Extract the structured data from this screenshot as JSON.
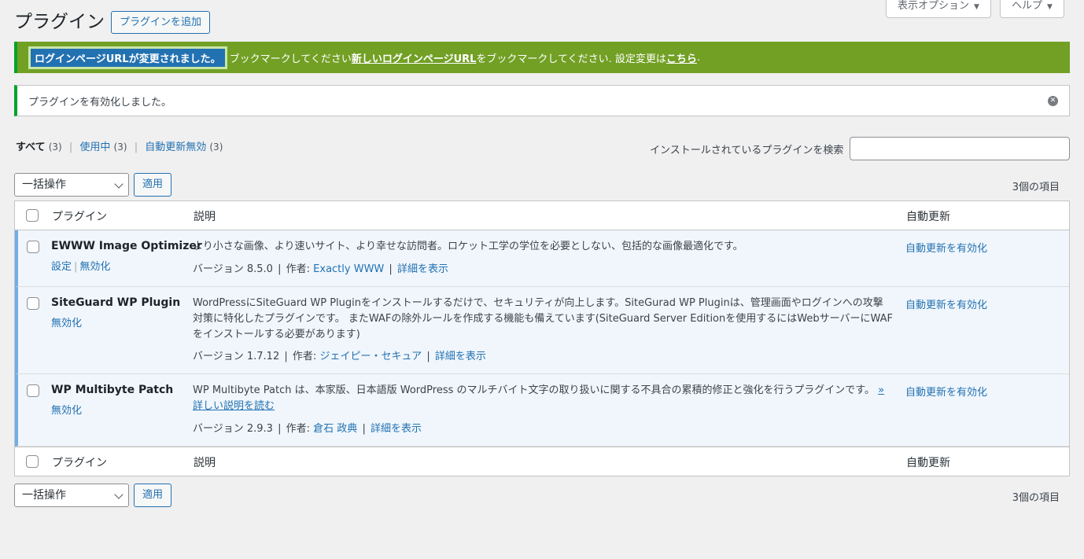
{
  "header": {
    "title": "プラグイン",
    "add_button": "プラグインを追加",
    "screen_options": "表示オプション",
    "help": "ヘルプ"
  },
  "notices": {
    "login_url": {
      "highlight": "ログインページURLが変更されました。",
      "text_before": "ブックマークしてください",
      "link1": "新しいログインページURL",
      "text_middle": "をブックマークしてください. 設定変更は",
      "link2": "こちら",
      "text_after": "."
    },
    "activated": "プラグインを有効化しました。"
  },
  "filters": [
    {
      "label": "すべて",
      "count": "(3)",
      "current": true
    },
    {
      "label": "使用中",
      "count": "(3)",
      "current": false
    },
    {
      "label": "自動更新無効",
      "count": "(3)",
      "current": false
    }
  ],
  "search": {
    "label": "インストールされているプラグインを検索",
    "value": ""
  },
  "bulk": {
    "select_value": "一括操作",
    "apply_label": "適用",
    "item_count": "3個の項目"
  },
  "columns": {
    "plugin": "プラグイン",
    "description": "説明",
    "auto_update": "自動更新"
  },
  "plugins": [
    {
      "name": "EWWW Image Optimizer",
      "actions": [
        "設定",
        "無効化"
      ],
      "description": "より小さな画像、より速いサイト、より幸せな訪問者。ロケット工学の学位を必要としない、包括的な画像最適化です。",
      "version": "バージョン 8.5.0",
      "author_label": "作者:",
      "author": "Exactly WWW",
      "details": "詳細を表示",
      "auto_update": "自動更新を有効化"
    },
    {
      "name": "SiteGuard WP Plugin",
      "actions": [
        "無効化"
      ],
      "description": "WordPressにSiteGuard WP Pluginをインストールするだけで、セキュリティが向上します。SiteGurad WP Pluginは、管理画面やログインへの攻撃対策に特化したプラグインです。 またWAFの除外ルールを作成する機能も備えています(SiteGuard Server Editionを使用するにはWebサーバーにWAFをインストールする必要があります)",
      "version": "バージョン 1.7.12",
      "author_label": "作者:",
      "author": "ジェイピー・セキュア",
      "details": "詳細を表示",
      "auto_update": "自動更新を有効化"
    },
    {
      "name": "WP Multibyte Patch",
      "actions": [
        "無効化"
      ],
      "description": "WP Multibyte Patch は、本家版、日本語版 WordPress のマルチバイト文字の取り扱いに関する不具合の累積的修正と強化を行うプラグインです。",
      "more_link": "» 詳しい説明を読む",
      "version": "バージョン 2.9.3",
      "author_label": "作者:",
      "author": "倉石 政典",
      "details": "詳細を表示",
      "auto_update": "自動更新を有効化"
    }
  ],
  "colors": {
    "accent": "#2271b1",
    "notice_green_bg": "#72a025",
    "active_row_bg": "#f0f6fc",
    "active_row_border": "#72aee6"
  }
}
